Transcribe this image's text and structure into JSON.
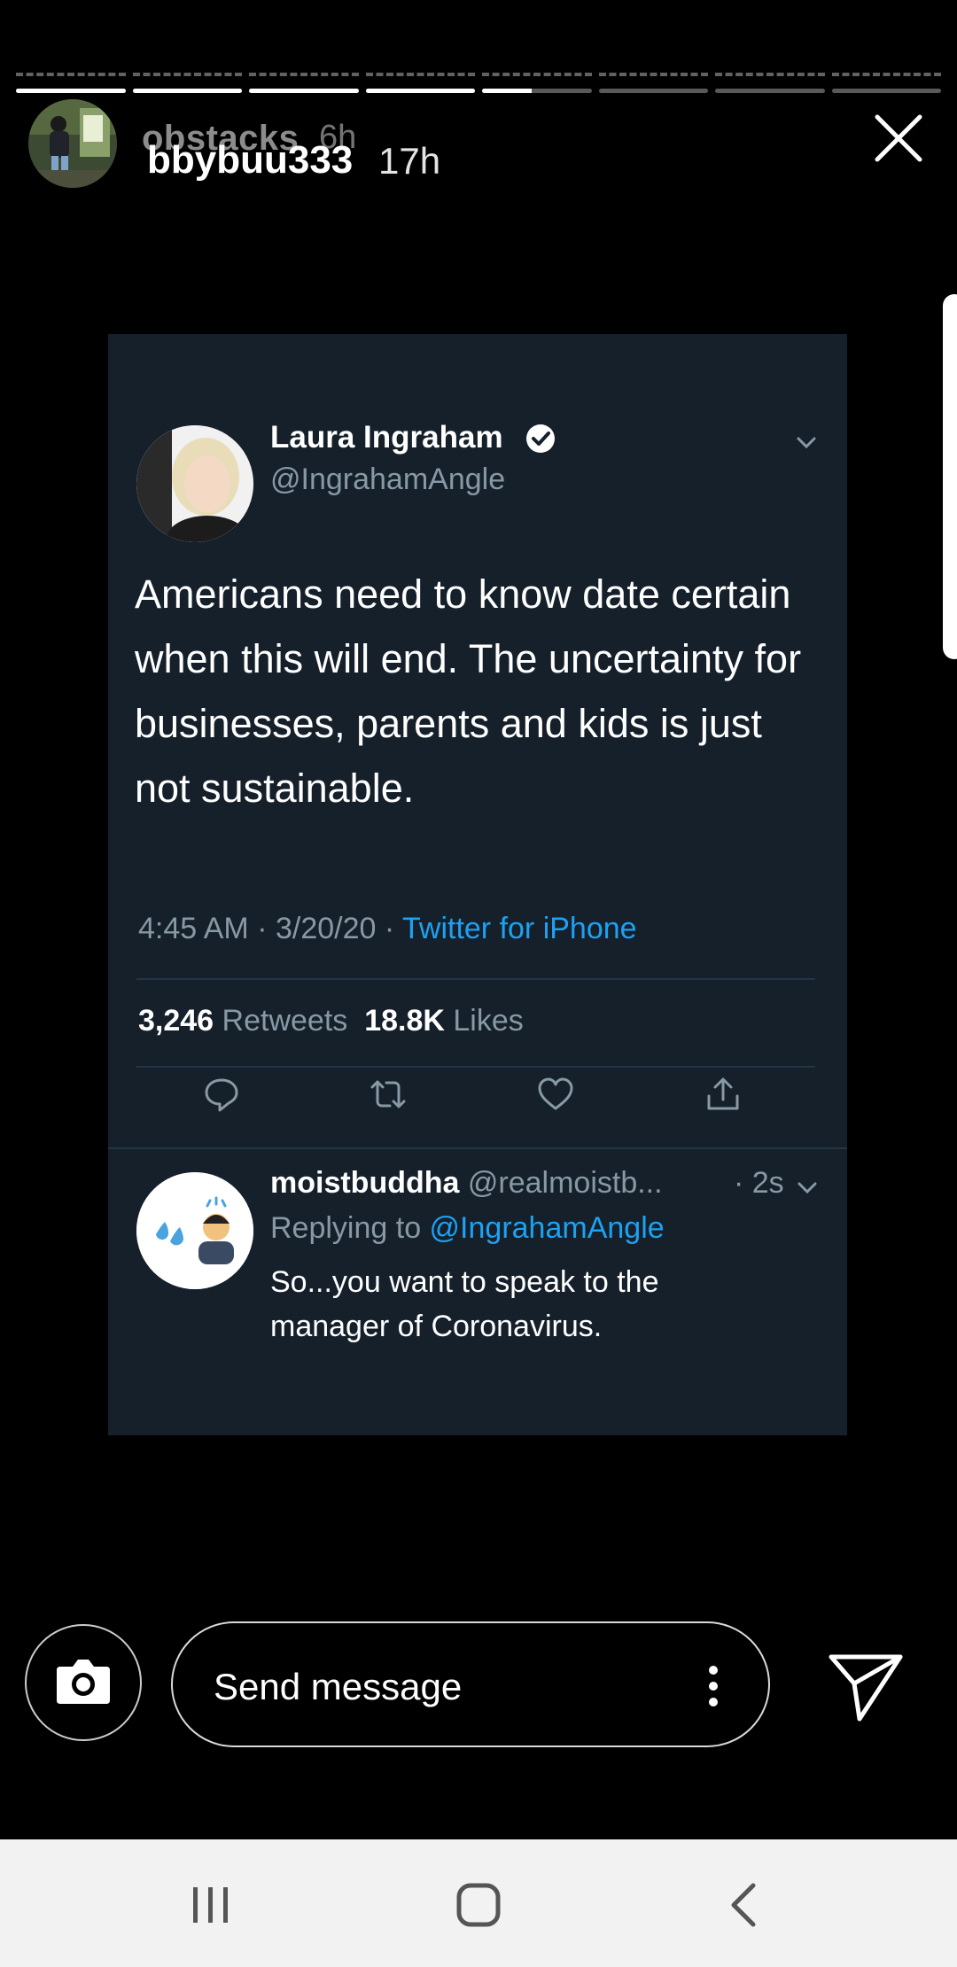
{
  "story": {
    "segment_count": 8,
    "segments_progress": [
      1,
      1,
      1,
      1,
      0.45,
      0,
      0,
      0
    ],
    "previous_username": "obstacks",
    "previous_time": "6h",
    "username": "bbybuu333",
    "time": "17h"
  },
  "tweet": {
    "author_name": "Laura Ingraham",
    "author_handle": "@IngrahamAngle",
    "text": "Americans need to know date certain when this will end.  The uncertainty for businesses, parents and kids is just not sustainable.",
    "timestamp": "4:45 AM · 3/20/20 · ",
    "source": "Twitter for iPhone",
    "retweets_count": "3,246",
    "retweets_label": "Retweets",
    "likes_count": "18.8K",
    "likes_label": "Likes"
  },
  "reply": {
    "author_name": "moistbuddha",
    "author_handle": "@realmoistb...",
    "time": "· 2s",
    "replying_label": "Replying to ",
    "replying_to": "@IngrahamAngle",
    "text": "So...you want to speak to the manager of Coronavirus."
  },
  "composer": {
    "placeholder": "Send message"
  },
  "icons": {
    "close": "close-icon",
    "camera": "camera-icon",
    "more": "more-vertical-icon",
    "send": "send-icon",
    "reply": "reply-icon",
    "retweet": "retweet-icon",
    "like": "like-icon",
    "share": "share-icon",
    "verified": "verified-badge-icon",
    "recent_apps": "recent-apps-icon",
    "home": "home-icon",
    "back": "back-icon"
  },
  "colors": {
    "background": "#000000",
    "tweet_background": "#15202b",
    "twitter_blue": "#1da1f2",
    "muted_text": "#8899a6",
    "navbar": "#f2f2f2"
  }
}
